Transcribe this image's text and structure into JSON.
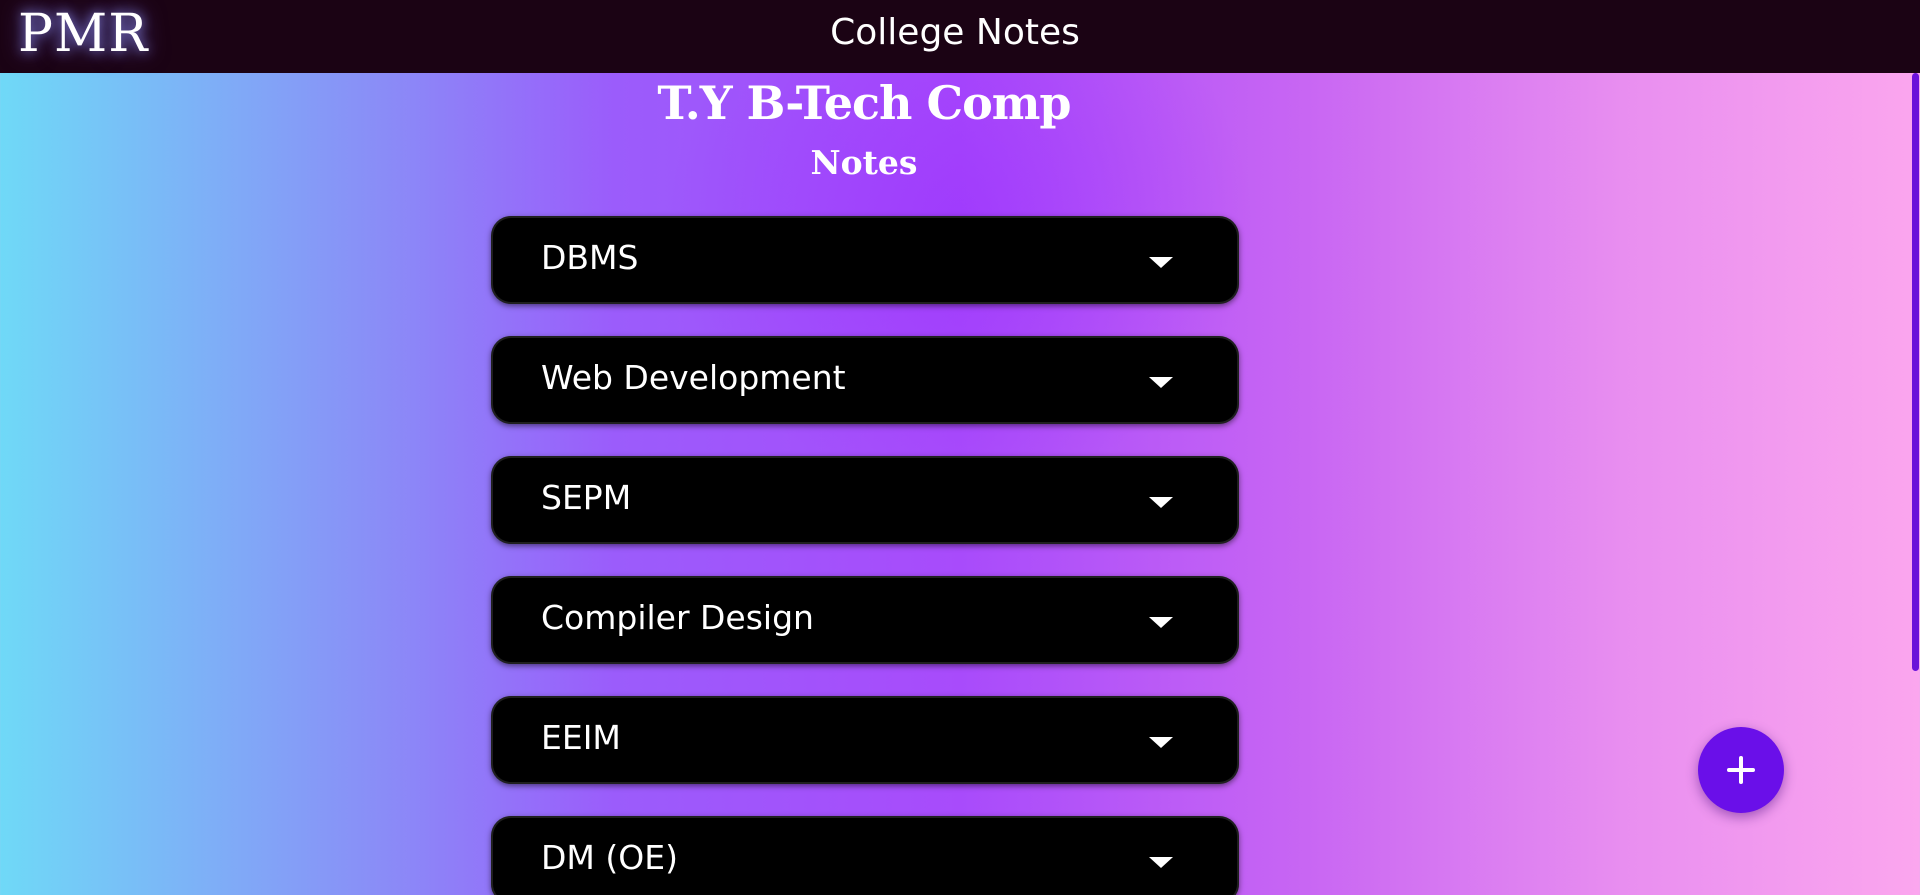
{
  "header": {
    "logo": "PMR",
    "title": "College Notes"
  },
  "main": {
    "heading": "T.Y B-Tech Comp",
    "subheading": "Notes",
    "subjects": [
      {
        "label": "DBMS"
      },
      {
        "label": "Web Development"
      },
      {
        "label": "SEPM"
      },
      {
        "label": "Compiler Design"
      },
      {
        "label": "EEIM"
      },
      {
        "label": "DM (OE)"
      }
    ]
  },
  "fab": {
    "icon": "plus-icon"
  },
  "colors": {
    "topbar": "#1b0314",
    "accordion_bg": "#000000",
    "fab": "#6a0fe9",
    "gradient_left": "#6fd9f7",
    "gradient_mid": "#a84bfb",
    "gradient_right": "#fba6ee"
  }
}
